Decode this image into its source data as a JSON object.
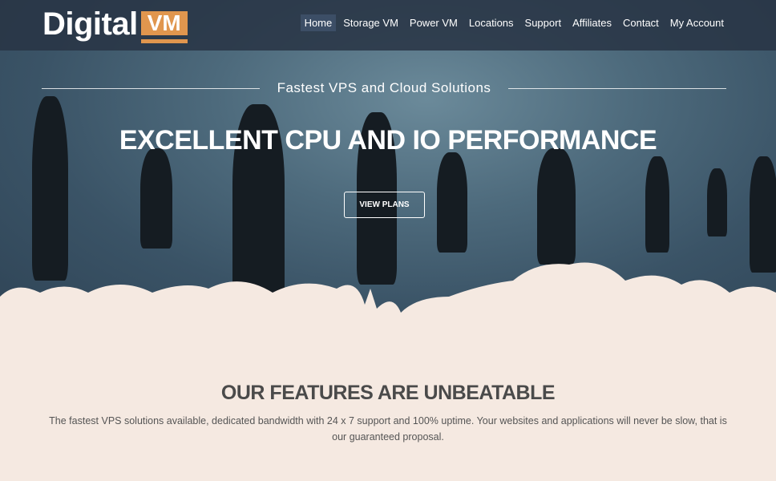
{
  "brand": {
    "name_part1": "Digital",
    "name_part2": "VM",
    "accent": "#e0964e"
  },
  "nav": {
    "items": [
      "Home",
      "Storage VM",
      "Power VM",
      "Locations",
      "Support",
      "Affiliates",
      "Contact",
      "My Account"
    ],
    "active": "Home"
  },
  "hero": {
    "tagline": "Fastest VPS and Cloud Solutions",
    "headline": "EXCELLENT CPU AND IO PERFORMANCE",
    "cta": "VIEW PLANS"
  },
  "features": {
    "title": "OUR FEATURES ARE UNBEATABLE",
    "description": "The fastest VPS solutions available, dedicated bandwidth with 24 x 7 support and 100% uptime. Your websites and applications will never be slow, that is our guaranteed proposal."
  }
}
